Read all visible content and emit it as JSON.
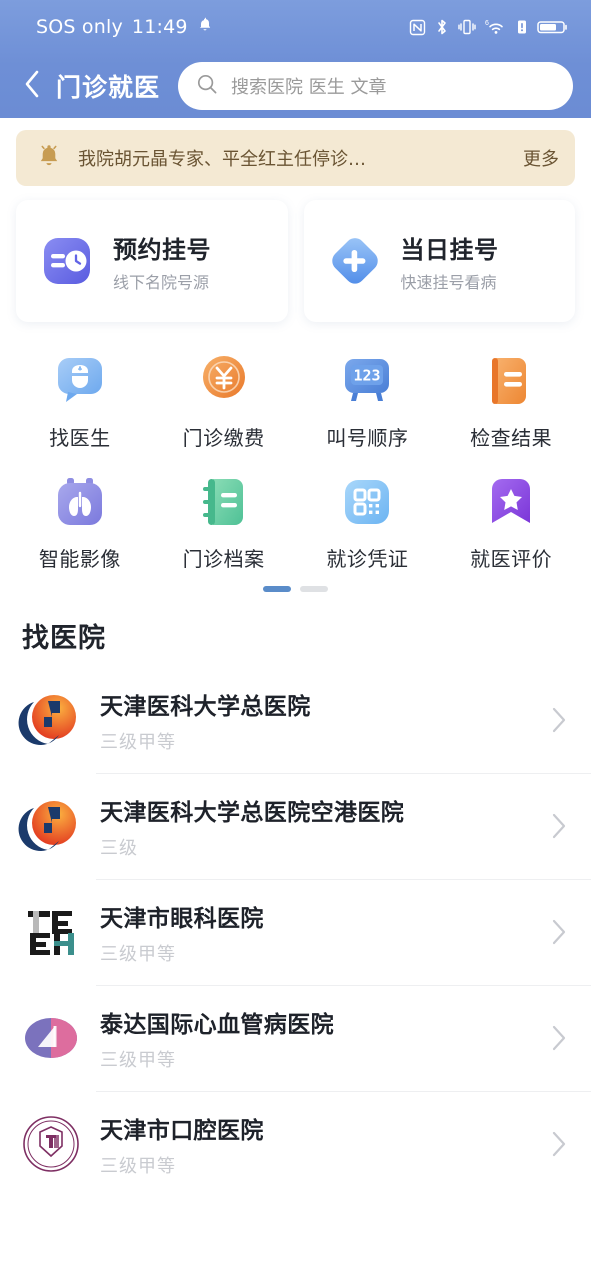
{
  "status_bar": {
    "carrier": "SOS only",
    "time": "11:49",
    "icons": [
      "bell-icon",
      "nfc-icon",
      "bluetooth-icon",
      "vibrate-icon",
      "wifi-6-icon",
      "signal-alert-icon",
      "battery-icon"
    ]
  },
  "header": {
    "back_icon": "chevron-left-icon",
    "title": "门诊就医",
    "search": {
      "icon": "search-icon",
      "placeholder": "搜索医院 医生 文章",
      "value": ""
    },
    "background_color": "#6e8fd6"
  },
  "notice": {
    "icon": "bell-icon",
    "text": "我院胡元晶专家、平全红主任停诊…",
    "more_label": "更多",
    "background_color": "#f4e9d3",
    "text_color": "#6a5433"
  },
  "quick_cards": [
    {
      "title": "预约挂号",
      "subtitle": "线下名院号源",
      "icon": "calendar-clock-icon",
      "color": "#6c6ce8"
    },
    {
      "title": "当日挂号",
      "subtitle": "快速挂号看病",
      "icon": "diamond-plus-icon",
      "color": "#5b9cf0"
    }
  ],
  "grid_items": [
    {
      "label": "找医生",
      "icon": "doctor-bubble-icon",
      "color": "#7fb0ee"
    },
    {
      "label": "门诊缴费",
      "icon": "yuan-coin-icon",
      "color": "#ef8c3f"
    },
    {
      "label": "叫号顺序",
      "icon": "queue-number-icon",
      "color": "#5a8de0"
    },
    {
      "label": "检查结果",
      "icon": "report-doc-icon",
      "color": "#f0923f"
    },
    {
      "label": "智能影像",
      "icon": "lungs-scan-icon",
      "color": "#8f8fe0"
    },
    {
      "label": "门诊档案",
      "icon": "green-notebook-icon",
      "color": "#6cc9a0"
    },
    {
      "label": "就诊凭证",
      "icon": "qr-code-icon",
      "color": "#7fc0f5"
    },
    {
      "label": "就医评价",
      "icon": "star-ribbon-icon",
      "color": "#8b54e0"
    }
  ],
  "pagination": {
    "total": 2,
    "active": 0
  },
  "section": {
    "title": "找医院"
  },
  "hospitals": [
    {
      "name": "天津医科大学总医院",
      "level": "三级甲等",
      "logo": "tmu-general-logo",
      "chevron": "chevron-right-icon"
    },
    {
      "name": "天津医科大学总医院空港医院",
      "level": "三级",
      "logo": "tmu-airport-logo",
      "chevron": "chevron-right-icon"
    },
    {
      "name": "天津市眼科医院",
      "level": "三级甲等",
      "logo": "teh-eye-logo",
      "chevron": "chevron-right-icon"
    },
    {
      "name": "泰达国际心血管病医院",
      "level": "三级甲等",
      "logo": "teda-heart-logo",
      "chevron": "chevron-right-icon"
    },
    {
      "name": "天津市口腔医院",
      "level": "三级甲等",
      "logo": "stomatology-logo",
      "chevron": "chevron-right-icon"
    }
  ]
}
